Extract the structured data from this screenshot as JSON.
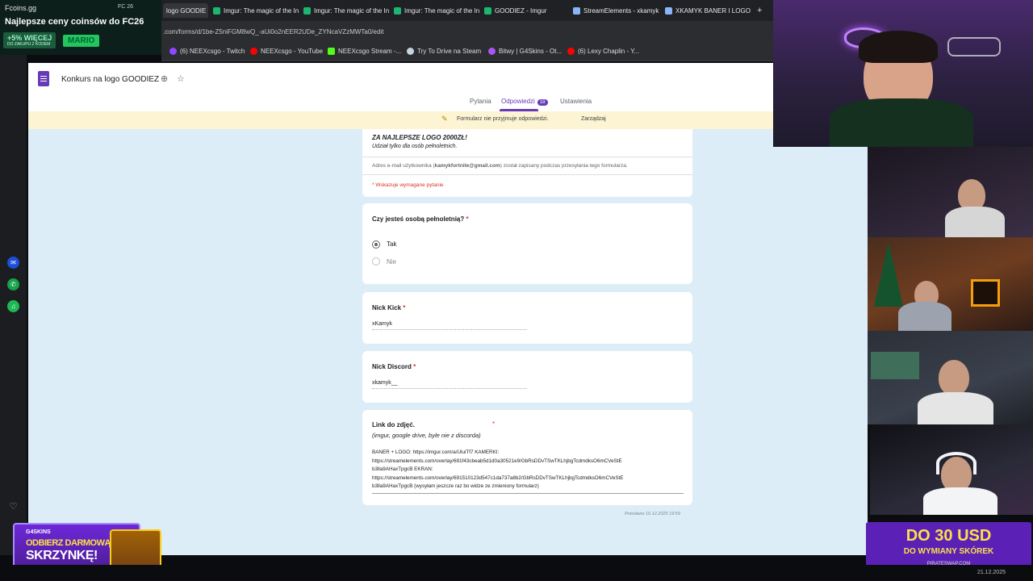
{
  "promo": {
    "brand": "Fcoins.gg",
    "headline": "Najlepsze ceny coinsów do FC26",
    "more": "+5% WIĘCEJ",
    "more_sub": "DO ZAKUPU Z KODEM",
    "code": "MARIO",
    "status": "FC 26"
  },
  "browser": {
    "tabs": [
      {
        "label": "logo GOODIE",
        "color": "#444"
      },
      {
        "label": "Imgur: The magic of the In",
        "color": "#1bb76e"
      },
      {
        "label": "Imgur: The magic of the In",
        "color": "#1bb76e"
      },
      {
        "label": "Imgur: The magic of the In",
        "color": "#1bb76e"
      },
      {
        "label": "GOODIEZ - Imgur",
        "color": "#1bb76e"
      },
      {
        "label": "StreamElements - xkamyk",
        "color": "#8ab4f8"
      },
      {
        "label": "XKAMYK BANER I LOGO",
        "color": "#8ab4f8"
      }
    ],
    "url": ".com/forms/d/1be-Z5niFGM8wQ_-aUi0o2nEER2UDe_ZYNcaVZzMWTa0/edit",
    "bookmarks": [
      {
        "label": "(6) NEEXcsgo - Twitch",
        "color": "#9146ff"
      },
      {
        "label": "NEEXcsgo - YouTube",
        "color": "#ff0000"
      },
      {
        "label": "NEEXcsgo Stream -...",
        "color": "#53fc18"
      },
      {
        "label": "Try To Drive na Steam",
        "color": "#c6d4df"
      },
      {
        "label": "Bitwy | G4Skins - Ot...",
        "color": "#a855f7"
      },
      {
        "label": "(6) Lexy Chaplin - Y...",
        "color": "#ff0000"
      }
    ]
  },
  "forms": {
    "title": "Konkurs na logo GOODIEZ",
    "tabs": {
      "questions": "Pytania",
      "responses": "Odpowiedzi",
      "responses_count": "18",
      "settings": "Ustawienia"
    },
    "notice": "Formularz nie przyjmuje odpowiedzi.",
    "manage": "Zarządzaj",
    "header_card": {
      "heading": "ZA NAJLEPSZE LOGO 2000ZŁ!",
      "sub": "Udział tylko dla osób pełnoletnich.",
      "email_prefix": "Adres e-mail użytkownika (",
      "email": "kamykfortnite@gmail.com",
      "email_suffix": ") został zapisany podczas przesyłania tego formularza.",
      "required_note": "* Wskazuje wymagane pytanie"
    },
    "q_adult": {
      "question": "Czy jesteś osobą pełnoletnią?",
      "option_yes": "Tak",
      "option_no": "Nie"
    },
    "q_kick": {
      "question": "Nick Kick",
      "answer": "xKamyk"
    },
    "q_discord": {
      "question": "Nick Discord",
      "answer": "xkamyk__"
    },
    "q_link": {
      "question": "Link do zdjęć.",
      "hint": "(imgur, google drive, byle nie z discorda)",
      "answer_lines": [
        "BANER + LOGO: https://imgur.com/a/UluiTf7        KAMERKI:",
        "https://streamelements.com/overlay/691f43cbeab5d1d0a30521e9/GbRsDDvTSwTKLhjbgTcdmdksO6mCVeStE",
        "b3lla9AHaxTpgcB        EKRAN:",
        "https://streamelements.com/overlay/691510123d547c1da737a8b2/GbRsDDvTSwTKLhjbgTcdmdksO6mCVeStE",
        "b3lla9AHaxTpgcB (wysyłam jeszcze raz bo widze ze zmieniony formularz)"
      ]
    },
    "submitted": "Przesłano 16.12.2025 19:59"
  },
  "ads": {
    "left_brand": "G4SKINS",
    "left_line1": "ODBIERZ DARMOWĄ",
    "left_line2": "SKRZYNKĘ!",
    "right_line1": "DO 30 USD",
    "right_line2": "DO WYMIANY SKÓREK",
    "right_line3": "PIRATESWAP.COM"
  },
  "taskbar": {
    "date": "21.12.2025"
  }
}
